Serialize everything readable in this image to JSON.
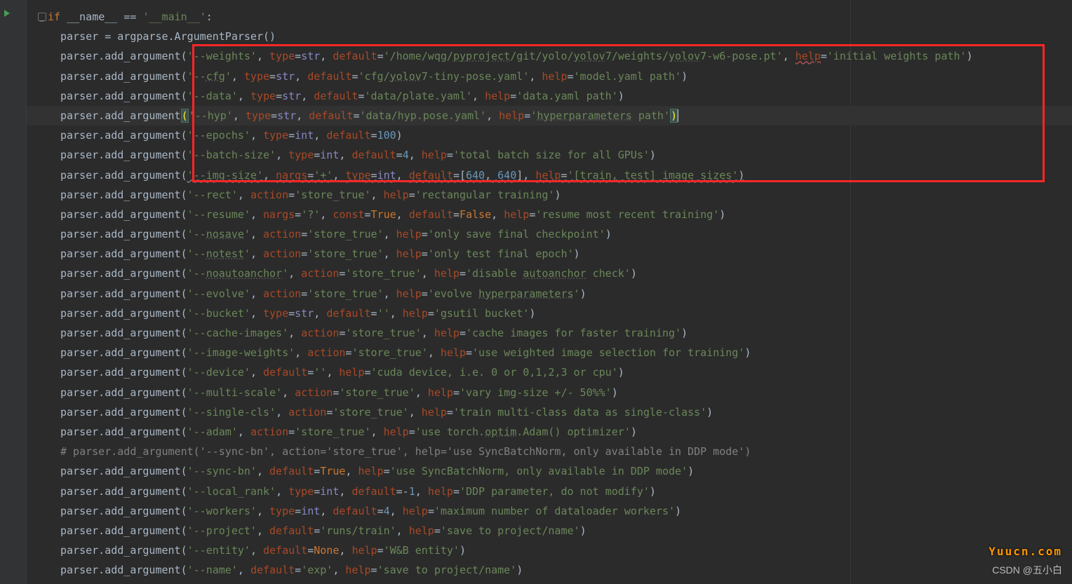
{
  "watermarks": {
    "site": "Yuucn.com",
    "credit": "CSDN @五小白"
  },
  "lines": [
    {
      "class": "indent1",
      "html": "<span class='fold' data-name='fold-icon' data-interactable='true'></span><span class='kw'>if</span> __name__ == <span class='str'>'__main__'</span>:"
    },
    {
      "class": "indent2",
      "html": "parser = argparse.ArgumentParser()"
    },
    {
      "class": "indent2",
      "html": "parser.add_argument(<span class='str'>'--weights'</span>, <span class='param'>type</span>=<span class='builtin'>str</span>, <span class='param'>default</span>=<span class='str'>'/home/wqg/<span class='underline'>pyproject</span>/git/yolo/<span class='underline'>yolov</span>7/weights/<span class='underline'>yolov</span>7-w6-pose.pt'</span>, <span class='param redwavy'>help</span>=<span class='str'>'initial weights path'</span>)"
    },
    {
      "class": "indent2",
      "html": "parser.add_argument(<span class='str'>'--<span class='underline'>cfg</span>'</span>, <span class='param'>type</span>=<span class='builtin'>str</span>, <span class='param'>default</span>=<span class='str'>'cfg/<span class='underline'>yolov</span>7-tiny-pose.yaml'</span>, <span class='param'>help</span>=<span class='str'>'model.yaml path'</span>)"
    },
    {
      "class": "indent2",
      "html": "parser.add_argument(<span class='str'>'--data'</span>, <span class='param'>type</span>=<span class='builtin'>str</span>, <span class='param'>default</span>=<span class='str'>'data/plate.yaml'</span>, <span class='param'>help</span>=<span class='str'>'data.yaml path'</span>)"
    },
    {
      "class": "indent2 hl-line",
      "html": "parser.add_argument<span class='brace-hl'>(</span><span class='str'>'--hyp'</span>, <span class='param'>type</span>=<span class='builtin'>str</span>, <span class='param'>default</span>=<span class='str'>'data/hyp.pose.yaml'</span>, <span class='param'>help</span>=<span class='str'>'<span class='underline'>hyperparameters</span> path'</span><span class='brace-hl2'>)</span><span class='caret'></span>"
    },
    {
      "class": "indent2",
      "html": "parser.add_argument(<span class='str'>'--epochs'</span>, <span class='param'>type</span>=<span class='builtin'>int</span>, <span class='param'>default</span>=<span class='num'>100</span>)"
    },
    {
      "class": "indent2",
      "html": "parser.add_argument(<span class='str'>'--batch-size'</span>, <span class='param'>type</span>=<span class='builtin'>int</span>, <span class='param'>default</span>=<span class='num'>4</span>, <span class='param'>help</span>=<span class='str'>'total batch size for all GPUs'</span>)"
    },
    {
      "class": "indent2",
      "html": "parser.add_argument(<span class='str wavy'>'--img-size'</span>, <span class='param wavy'>nargs</span><span class='wavy'>=</span><span class='str wavy'>'+'</span>, <span class='param wavy'>type</span><span class='wavy'>=</span><span class='builtin wavy'>int</span>, <span class='param wavy'>default</span><span class='wavy'>=[</span><span class='num wavy'>640</span><span class='wavy'>, </span><span class='num wavy'>640</span><span class='wavy'>]</span>, <span class='param wavy'>help</span><span class='wavy'>=</span><span class='str wavy'>'[train, test] image sizes'</span><span class='wavy'>)</span>"
    },
    {
      "class": "indent2",
      "html": "parser.add_argument(<span class='str'>'--rect'</span>, <span class='param'>action</span>=<span class='str'>'store_true'</span>, <span class='param'>help</span>=<span class='str'>'rectangular training'</span>)"
    },
    {
      "class": "indent2",
      "html": "parser.add_argument(<span class='str'>'--resume'</span>, <span class='param'>nargs</span>=<span class='str'>'?'</span>, <span class='param'>const</span>=<span class='kw'>True</span>, <span class='param'>default</span>=<span class='kw'>False</span>, <span class='param'>help</span>=<span class='str'>'resume most recent training'</span>)"
    },
    {
      "class": "indent2",
      "html": "parser.add_argument(<span class='str'>'--<span class='underline'>nosave</span>'</span>, <span class='param'>action</span>=<span class='str'>'store_true'</span>, <span class='param'>help</span>=<span class='str'>'only save final checkpoint'</span>)"
    },
    {
      "class": "indent2",
      "html": "parser.add_argument(<span class='str'>'--<span class='underline'>notest</span>'</span>, <span class='param'>action</span>=<span class='str'>'store_true'</span>, <span class='param'>help</span>=<span class='str'>'only test final epoch'</span>)"
    },
    {
      "class": "indent2",
      "html": "parser.add_argument(<span class='str'>'--<span class='underline'>noautoanchor</span>'</span>, <span class='param'>action</span>=<span class='str'>'store_true'</span>, <span class='param'>help</span>=<span class='str'>'disable <span class='underline'>autoanchor</span> check'</span>)"
    },
    {
      "class": "indent2",
      "html": "parser.add_argument(<span class='str'>'--evolve'</span>, <span class='param'>action</span>=<span class='str'>'store_true'</span>, <span class='param'>help</span>=<span class='str'>'evolve <span class='underline'>hyperparameters</span>'</span>)"
    },
    {
      "class": "indent2",
      "html": "parser.add_argument(<span class='str'>'--bucket'</span>, <span class='param'>type</span>=<span class='builtin'>str</span>, <span class='param'>default</span>=<span class='str'>''</span>, <span class='param'>help</span>=<span class='str'>'gsutil bucket'</span>)"
    },
    {
      "class": "indent2",
      "html": "parser.add_argument(<span class='str'>'--cache-images'</span>, <span class='param'>action</span>=<span class='str'>'store_true'</span>, <span class='param'>help</span>=<span class='str'>'cache images for faster training'</span>)"
    },
    {
      "class": "indent2",
      "html": "parser.add_argument(<span class='str'>'--image-weights'</span>, <span class='param'>action</span>=<span class='str'>'store_true'</span>, <span class='param'>help</span>=<span class='str'>'use weighted image selection for training'</span>)"
    },
    {
      "class": "indent2",
      "html": "parser.add_argument(<span class='str'>'--device'</span>, <span class='param'>default</span>=<span class='str'>''</span>, <span class='param'>help</span>=<span class='str'>'cuda device, i.e. 0 or 0,1,2,3 or cpu'</span>)"
    },
    {
      "class": "indent2",
      "html": "parser.add_argument(<span class='str'>'--multi-scale'</span>, <span class='param'>action</span>=<span class='str'>'store_true'</span>, <span class='param'>help</span>=<span class='str'>'vary img-size +/- 50%%'</span>)"
    },
    {
      "class": "indent2",
      "html": "parser.add_argument(<span class='str'>'--single-cls'</span>, <span class='param'>action</span>=<span class='str'>'store_true'</span>, <span class='param'>help</span>=<span class='str'>'train multi-class data as single-class'</span>)"
    },
    {
      "class": "indent2",
      "html": "parser.add_argument(<span class='str'>'--adam'</span>, <span class='param'>action</span>=<span class='str'>'store_true'</span>, <span class='param'>help</span>=<span class='str'>'use torch.<span class='underline'>optim</span>.Adam() optimizer'</span>)"
    },
    {
      "class": "indent2",
      "html": "<span class='comment'># parser.add_argument('--sync-bn', action='store_true', help='use SyncBatchNorm, only available in DDP mode')</span>"
    },
    {
      "class": "indent2",
      "html": "parser.add_argument(<span class='str'>'--sync-bn'</span>, <span class='param'>default</span>=<span class='kw'>True</span>, <span class='param'>help</span>=<span class='str'>'use SyncBatchNorm, only available in DDP mode'</span>)"
    },
    {
      "class": "indent2",
      "html": "parser.add_argument(<span class='str'>'--local_rank'</span>, <span class='param'>type</span>=<span class='builtin'>int</span>, <span class='param'>default</span>=-<span class='num'>1</span>, <span class='param'>help</span>=<span class='str'>'DDP parameter, do not modify'</span>)"
    },
    {
      "class": "indent2",
      "html": "parser.add_argument(<span class='str'>'--workers'</span>, <span class='param'>type</span>=<span class='builtin'>int</span>, <span class='param'>default</span>=<span class='num'>4</span>, <span class='param'>help</span>=<span class='str'>'maximum number of dataloader workers'</span>)"
    },
    {
      "class": "indent2",
      "html": "parser.add_argument(<span class='str'>'--project'</span>, <span class='param'>default</span>=<span class='str'>'runs/train'</span>, <span class='param'>help</span>=<span class='str'>'save to project/name'</span>)"
    },
    {
      "class": "indent2",
      "html": "parser.add_argument(<span class='str'>'--entity'</span>, <span class='param'>default</span>=<span class='kw'>None</span>, <span class='param'>help</span>=<span class='str'>'W&B entity'</span>)"
    },
    {
      "class": "indent2",
      "html": "parser.add_argument(<span class='str'>'--name'</span>, <span class='param'>default</span>=<span class='str'>'exp'</span>, <span class='param'>help</span>=<span class='str'>'save to project/name'</span>)"
    }
  ]
}
